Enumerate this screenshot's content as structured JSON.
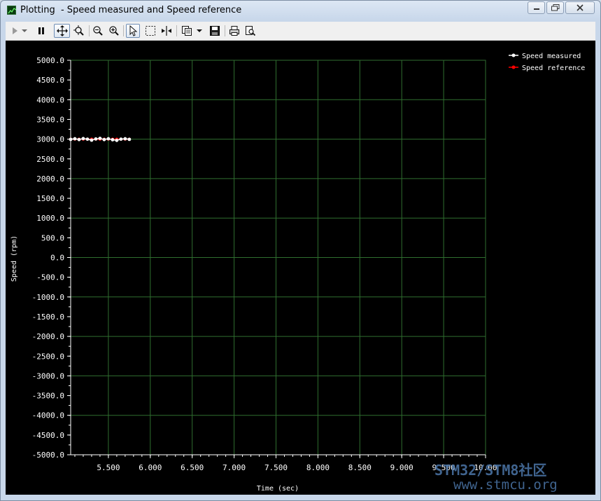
{
  "window": {
    "title": "Plotting  - Speed measured and Speed reference",
    "buttons": {
      "minimize": "minimize",
      "maximize": "maximize",
      "close": "close"
    }
  },
  "toolbar": {
    "icons": [
      "play-icon",
      "dropdown-arrow-icon",
      "pause-icon",
      "pan-icon",
      "zoom-auto-icon",
      "zoom-out-icon",
      "zoom-in-icon",
      "select-pointer-icon",
      "select-rectangle-icon",
      "cursor-icon",
      "copy-icon",
      "dropdown-arrow-icon",
      "save-icon",
      "print-icon",
      "print-preview-icon"
    ]
  },
  "colors": {
    "plot_background": "#000000",
    "grid": "#2f6e2f",
    "axis": "#ffffff",
    "speed_measured": "#ffffff",
    "speed_reference": "#ff0000"
  },
  "watermark": {
    "line1": "STM32/STM8社区",
    "line2": "www.stmcu.org"
  },
  "chart_data": {
    "type": "line",
    "xlabel": "Time (sec)",
    "ylabel": "Speed (rpm)",
    "xlim": [
      5.05,
      10.0
    ],
    "ylim": [
      -5000,
      5000
    ],
    "grid": true,
    "legend_position": "top-right",
    "x_ticks": [
      "5.500",
      "6.000",
      "6.500",
      "7.000",
      "7.500",
      "8.000",
      "8.500",
      "9.000",
      "9.500",
      "10.00"
    ],
    "y_ticks": [
      "5000.0",
      "4500.0",
      "4000.0",
      "3500.0",
      "3000.0",
      "2500.0",
      "2000.0",
      "1500.0",
      "1000.0",
      "500.0",
      "0.0",
      "-500.0",
      "-1000.0",
      "-1500.0",
      "-2000.0",
      "-2500.0",
      "-3000.0",
      "-3500.0",
      "-4000.0",
      "-4500.0",
      "-5000.0"
    ],
    "series": [
      {
        "name": "Speed measured",
        "color": "#ffffff",
        "x": [
          5.05,
          5.1,
          5.15,
          5.2,
          5.25,
          5.3,
          5.35,
          5.4,
          5.45,
          5.5,
          5.55,
          5.6,
          5.65,
          5.7,
          5.75
        ],
        "values": [
          2995,
          3010,
          2990,
          3015,
          3000,
          2975,
          3005,
          3020,
          2990,
          3010,
          2985,
          2970,
          3000,
          3010,
          2995
        ]
      },
      {
        "name": "Speed reference",
        "color": "#ff0000",
        "x": [
          5.05,
          5.1,
          5.15,
          5.2,
          5.25,
          5.3,
          5.35,
          5.4,
          5.45,
          5.5,
          5.55,
          5.6,
          5.65,
          5.7,
          5.75
        ],
        "values": [
          3000,
          3000,
          3000,
          3000,
          3000,
          3000,
          3000,
          3000,
          3000,
          3000,
          3000,
          3000,
          3000,
          3000,
          3000
        ]
      }
    ]
  }
}
